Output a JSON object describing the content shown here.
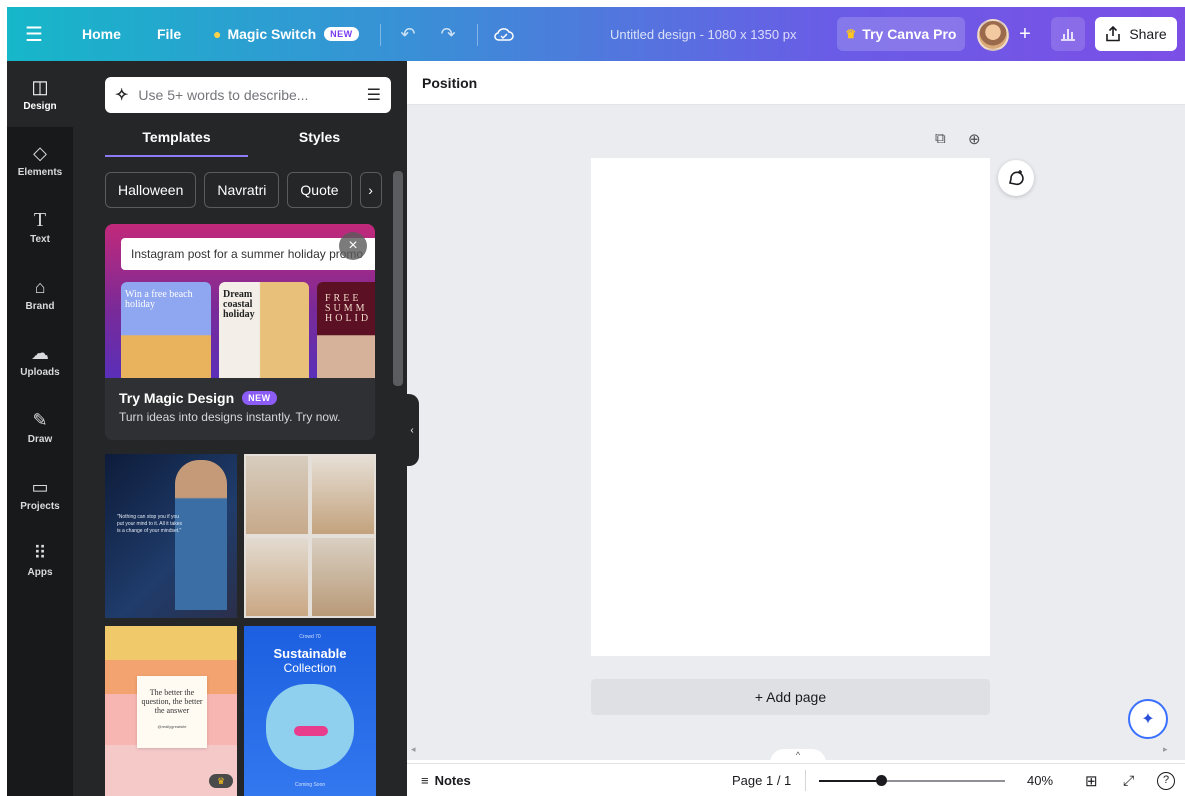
{
  "topbar": {
    "home": "Home",
    "file": "File",
    "magic_switch": "Magic Switch",
    "magic_switch_badge": "NEW",
    "title": "Untitled design - 1080 x 1350 px",
    "try_pro": "Try Canva Pro",
    "share": "Share"
  },
  "rail": {
    "items": [
      {
        "label": "Design",
        "icon": "design-icon"
      },
      {
        "label": "Elements",
        "icon": "elements-icon"
      },
      {
        "label": "Text",
        "icon": "text-icon"
      },
      {
        "label": "Brand",
        "icon": "brand-icon"
      },
      {
        "label": "Uploads",
        "icon": "uploads-icon"
      },
      {
        "label": "Draw",
        "icon": "draw-icon"
      },
      {
        "label": "Projects",
        "icon": "projects-icon"
      },
      {
        "label": "Apps",
        "icon": "apps-icon"
      }
    ]
  },
  "panel": {
    "search_placeholder": "Use 5+ words to describe...",
    "tabs": [
      "Templates",
      "Styles"
    ],
    "chips": [
      "Halloween",
      "Navratri",
      "Quote"
    ],
    "magic_card": {
      "prompt": "Instagram post for a summer holiday promo",
      "title": "Try Magic Design",
      "badge": "NEW",
      "subtitle": "Turn ideas into designs instantly. Try now.",
      "card1_text": "Win a free beach holiday",
      "card2_text": "Dream coastal holiday",
      "card3_text": "FREE SUMM HOLID"
    },
    "templates": [
      {
        "quote": "\"Nothing can stop you if you put your mind to it. All it takes is a change of your mindset.\""
      },
      {
        "caption": ""
      },
      {
        "quote": "The better the question, the better the answer",
        "handle": "@reallygreatsite"
      },
      {
        "brand": "Crowd 70",
        "title": "Sustainable",
        "subtitle": "Collection",
        "footer": "Coming Soon"
      }
    ]
  },
  "canvas": {
    "position_label": "Position",
    "add_page": "+ Add page"
  },
  "bottombar": {
    "notes": "Notes",
    "page_indicator": "Page 1 / 1",
    "zoom": "40%",
    "zoom_value": 0.4
  },
  "colors": {
    "accent_purple": "#8b7cf6",
    "panel_bg": "#252627",
    "rail_bg": "#18191b"
  }
}
